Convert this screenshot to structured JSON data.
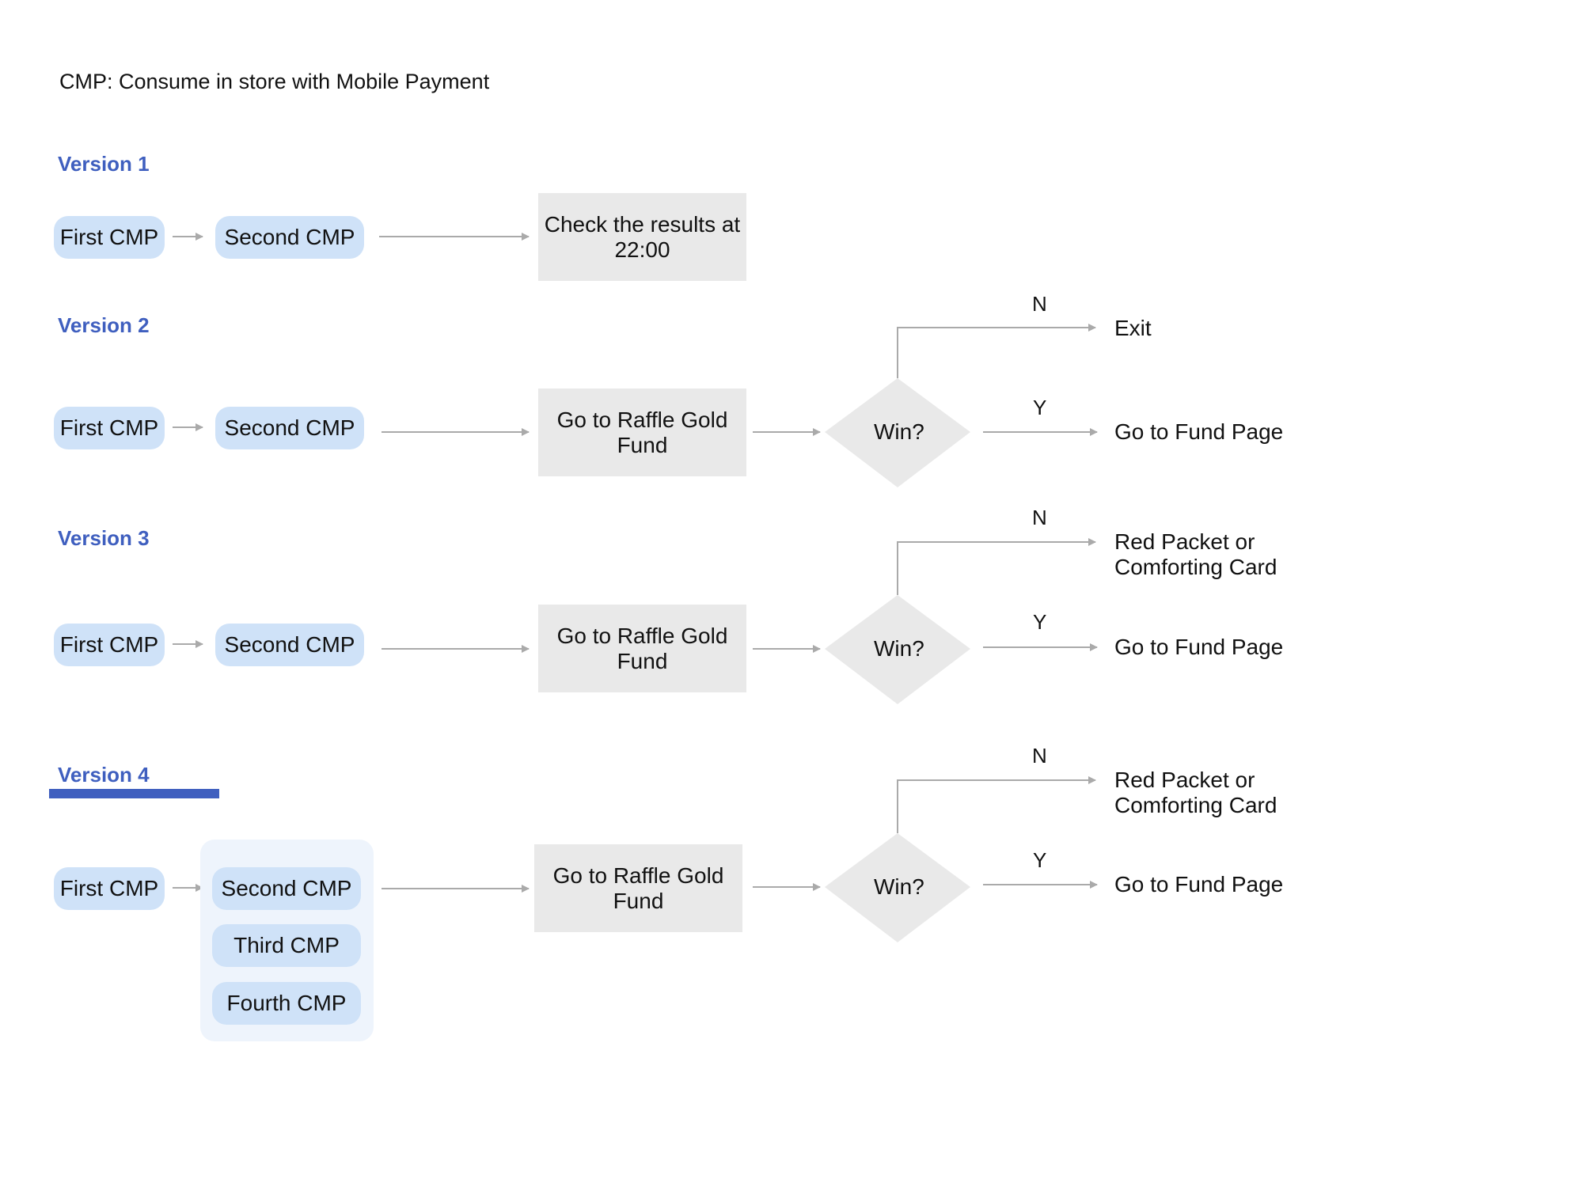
{
  "caption": "CMP: Consume in store with Mobile Payment",
  "colors": {
    "accent": "#3f5fbf",
    "pill": "#cfe2f8",
    "group": "#eef4fc",
    "box": "#e9e9e9",
    "connector": "#aaaaaa"
  },
  "versions": [
    {
      "title": "Version 1",
      "steps": [
        "First CMP",
        "Second CMP"
      ],
      "action": "Check the results at 22:00"
    },
    {
      "title": "Version 2",
      "steps": [
        "First CMP",
        "Second CMP"
      ],
      "action": "Go to Raffle Gold Fund",
      "decision": "Win?",
      "no_label": "N",
      "no_outcome": "Exit",
      "yes_label": "Y",
      "yes_outcome": "Go to Fund Page"
    },
    {
      "title": "Version 3",
      "steps": [
        "First CMP",
        "Second CMP"
      ],
      "action": "Go to Raffle Gold Fund",
      "decision": "Win?",
      "no_label": "N",
      "no_outcome": "Red Packet or Comforting Card",
      "yes_label": "Y",
      "yes_outcome": "Go to Fund Page"
    },
    {
      "title": "Version 4",
      "selected": true,
      "steps": [
        "First CMP",
        "Second CMP",
        "Third CMP",
        "Fourth CMP"
      ],
      "action": "Go to Raffle Gold Fund",
      "decision": "Win?",
      "no_label": "N",
      "no_outcome": "Red Packet or Comforting Card",
      "yes_label": "Y",
      "yes_outcome": "Go to Fund Page"
    }
  ]
}
